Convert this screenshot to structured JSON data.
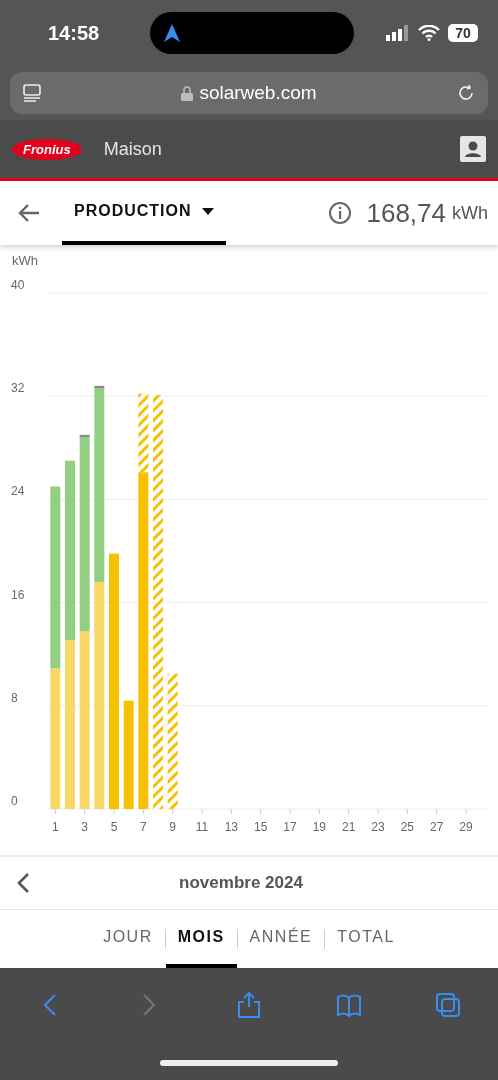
{
  "status_bar": {
    "time": "14:58",
    "battery": "70"
  },
  "browser": {
    "url": "solarweb.com"
  },
  "app_header": {
    "logo": "Fronius",
    "title": "Maison"
  },
  "toolbar": {
    "view": "PRODUCTION",
    "total": "168,74",
    "unit": "kWh"
  },
  "chart": {
    "series_styles": [
      {
        "hatched": false
      },
      {
        "hatched": false
      },
      {
        "hatched": false
      },
      {
        "hatched": false
      },
      {
        "hatched": true
      }
    ],
    "chart_data": {
      "type": "bar",
      "stacked": true,
      "grid": true,
      "ylabel": "kWh",
      "x": [
        1,
        2,
        3,
        4,
        5,
        6,
        7,
        8,
        9
      ],
      "xticks": [
        1,
        3,
        5,
        7,
        9,
        11,
        13,
        15,
        17,
        19,
        21,
        23,
        25,
        27,
        29
      ],
      "xlim": [
        0.5,
        30.5
      ],
      "yticks": [
        0,
        8,
        16,
        24,
        32,
        40
      ],
      "ylim": [
        0,
        40
      ],
      "series": [
        {
          "color": "#f9d767",
          "values": [
            10.9,
            13.1,
            13.8,
            17.6,
            null,
            null,
            null,
            null,
            null
          ]
        },
        {
          "color": "#f5c100",
          "values": [
            null,
            null,
            null,
            null,
            19.8,
            8.4,
            26.1,
            null,
            null
          ]
        },
        {
          "color": "#93cf82",
          "values": [
            14.1,
            13.9,
            15.0,
            15.0,
            null,
            null,
            null,
            null,
            null
          ]
        },
        {
          "color": "#8a8a8a",
          "values": [
            null,
            null,
            0.2,
            0.2,
            null,
            null,
            null,
            null,
            null
          ]
        },
        {
          "color": "#f5c100",
          "values": [
            null,
            null,
            null,
            null,
            null,
            null,
            6.1,
            32.1,
            10.5
          ]
        }
      ]
    }
  },
  "period": {
    "label": "novembre 2024"
  },
  "tabs": [
    {
      "label": "JOUR",
      "selected": false
    },
    {
      "label": "MOIS",
      "selected": true
    },
    {
      "label": "ANNÉE",
      "selected": false
    },
    {
      "label": "TOTAL",
      "selected": false
    }
  ],
  "safari_toolbar": [
    {
      "kind": "back",
      "disabled": false
    },
    {
      "kind": "forward",
      "disabled": true
    },
    {
      "kind": "share",
      "disabled": false
    },
    {
      "kind": "bookmarks",
      "disabled": false
    },
    {
      "kind": "tabs",
      "disabled": false
    }
  ]
}
